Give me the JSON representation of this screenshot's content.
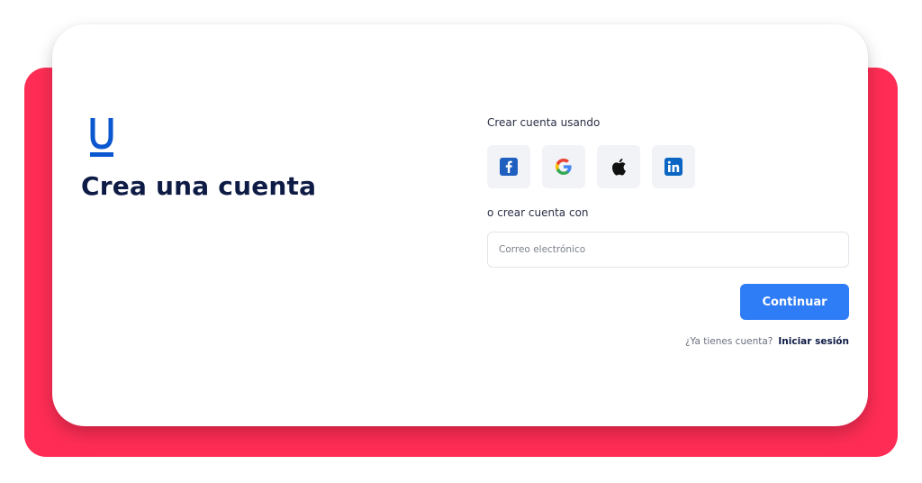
{
  "page": {
    "title": "Crea una cuenta"
  },
  "social": {
    "label": "Crear cuenta usando",
    "providers": [
      {
        "name": "facebook",
        "icon": "facebook-icon"
      },
      {
        "name": "google",
        "icon": "google-icon"
      },
      {
        "name": "apple",
        "icon": "apple-icon"
      },
      {
        "name": "linkedin",
        "icon": "linkedin-icon"
      }
    ]
  },
  "email": {
    "label": "o crear cuenta con",
    "placeholder": "Correo electrónico",
    "value": ""
  },
  "actions": {
    "continue_label": "Continuar"
  },
  "footer": {
    "question": "¿Ya tienes cuenta?",
    "login_link": "Iniciar sesión"
  },
  "colors": {
    "accent_background": "#ff2d55",
    "primary_button": "#2e7cf6",
    "logo": "#0b57d0",
    "title": "#0e1b45"
  }
}
